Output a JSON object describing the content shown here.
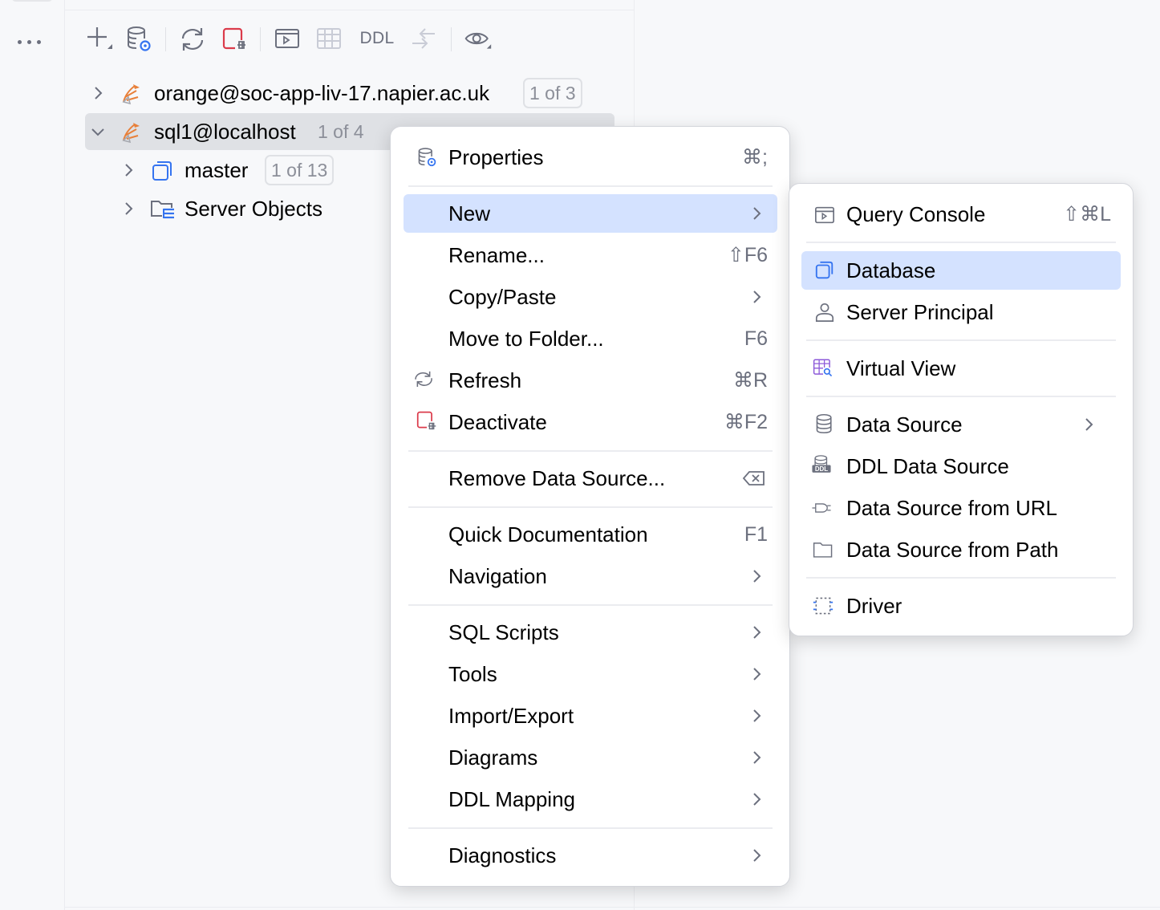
{
  "toolbar": {
    "ddl_label": "DDL"
  },
  "tree": [
    {
      "label": "orange@soc-app-liv-17.napier.ac.uk",
      "badge": "1 of 3"
    },
    {
      "label": "sql1@localhost",
      "badge": "1 of 4"
    },
    {
      "label": "master",
      "badge": "1 of 13"
    },
    {
      "label": "Server Objects"
    }
  ],
  "context_menu": {
    "items": [
      {
        "label": "Properties",
        "shortcut": "⌘;"
      },
      {
        "label": "New"
      },
      {
        "label": "Rename...",
        "shortcut": "⇧F6"
      },
      {
        "label": "Copy/Paste"
      },
      {
        "label": "Move to Folder...",
        "shortcut": "F6"
      },
      {
        "label": "Refresh",
        "shortcut": "⌘R"
      },
      {
        "label": "Deactivate",
        "shortcut": "⌘F2"
      },
      {
        "label": "Remove Data Source..."
      },
      {
        "label": "Quick Documentation",
        "shortcut": "F1"
      },
      {
        "label": "Navigation"
      },
      {
        "label": "SQL Scripts"
      },
      {
        "label": "Tools"
      },
      {
        "label": "Import/Export"
      },
      {
        "label": "Diagrams"
      },
      {
        "label": "DDL Mapping"
      },
      {
        "label": "Diagnostics"
      }
    ]
  },
  "submenu": {
    "items": [
      {
        "label": "Query Console",
        "shortcut": "⇧⌘L"
      },
      {
        "label": "Database"
      },
      {
        "label": "Server Principal"
      },
      {
        "label": "Virtual View"
      },
      {
        "label": "Data Source"
      },
      {
        "label": "DDL Data Source",
        "icon_text": "DDL"
      },
      {
        "label": "Data Source from URL"
      },
      {
        "label": "Data Source from Path"
      },
      {
        "label": "Driver"
      }
    ]
  },
  "colors": {
    "highlight": "#d4e2ff",
    "selection": "#dfe1e5",
    "accent_blue": "#3574f0",
    "deactivate_red": "#db3b4b",
    "virtual_view_purple": "#8d5ad9"
  }
}
